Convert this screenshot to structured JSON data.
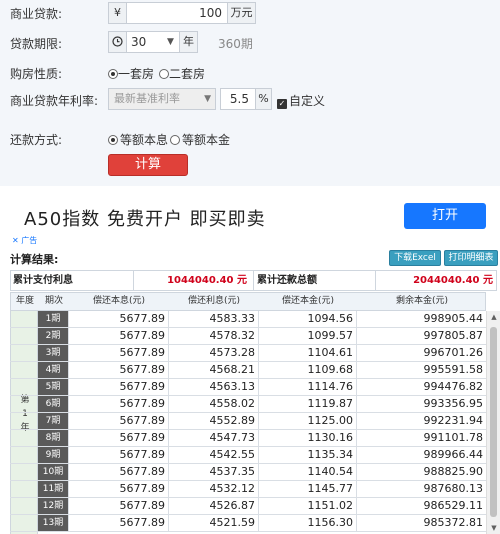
{
  "form": {
    "loan_amount": {
      "label": "商业贷款:",
      "prefix": "¥",
      "value": "100",
      "unit": "万元"
    },
    "loan_term": {
      "label": "贷款期限:",
      "value": "30",
      "unit": "年",
      "months": "360期"
    },
    "house_type": {
      "label": "购房性质:",
      "options": [
        "一套房",
        "二套房"
      ],
      "selected": "一套房"
    },
    "rate": {
      "label": "商业贷款年利率:",
      "select_value": "最新基准利率",
      "value": "5.5",
      "unit": "%",
      "custom_label": "自定义",
      "custom_checked": true
    },
    "repay_method": {
      "label": "还款方式:",
      "options": [
        "等额本息",
        "等额本金"
      ],
      "selected": "等额本息"
    },
    "calc_button": "计算"
  },
  "ad": {
    "text": "A50指数 免费开户 即买即卖",
    "button": "打开",
    "mark": "广告"
  },
  "result": {
    "title": "计算结果:",
    "download_button": "下载Excel",
    "print_button": "打印明细表",
    "summary": {
      "interest_label": "累计支付利息",
      "interest_value": "1044040.40 元",
      "total_label": "累计还款总额",
      "total_value": "2044040.40 元"
    },
    "columns": [
      "年度",
      "期次",
      "偿还本息(元)",
      "偿还利息(元)",
      "偿还本金(元)",
      "剩余本金(元)"
    ],
    "year_label": [
      "第",
      "1",
      "年"
    ],
    "rows": [
      {
        "period": "1期",
        "payment": "5677.89",
        "interest": "4583.33",
        "principal": "1094.56",
        "remaining": "998905.44"
      },
      {
        "period": "2期",
        "payment": "5677.89",
        "interest": "4578.32",
        "principal": "1099.57",
        "remaining": "997805.87"
      },
      {
        "period": "3期",
        "payment": "5677.89",
        "interest": "4573.28",
        "principal": "1104.61",
        "remaining": "996701.26"
      },
      {
        "period": "4期",
        "payment": "5677.89",
        "interest": "4568.21",
        "principal": "1109.68",
        "remaining": "995591.58"
      },
      {
        "period": "5期",
        "payment": "5677.89",
        "interest": "4563.13",
        "principal": "1114.76",
        "remaining": "994476.82"
      },
      {
        "period": "6期",
        "payment": "5677.89",
        "interest": "4558.02",
        "principal": "1119.87",
        "remaining": "993356.95"
      },
      {
        "period": "7期",
        "payment": "5677.89",
        "interest": "4552.89",
        "principal": "1125.00",
        "remaining": "992231.94"
      },
      {
        "period": "8期",
        "payment": "5677.89",
        "interest": "4547.73",
        "principal": "1130.16",
        "remaining": "991101.78"
      },
      {
        "period": "9期",
        "payment": "5677.89",
        "interest": "4542.55",
        "principal": "1135.34",
        "remaining": "989966.44"
      },
      {
        "period": "10期",
        "payment": "5677.89",
        "interest": "4537.35",
        "principal": "1140.54",
        "remaining": "988825.90"
      },
      {
        "period": "11期",
        "payment": "5677.89",
        "interest": "4532.12",
        "principal": "1145.77",
        "remaining": "987680.13"
      },
      {
        "period": "12期",
        "payment": "5677.89",
        "interest": "4526.87",
        "principal": "1151.02",
        "remaining": "986529.11"
      },
      {
        "period": "13期",
        "payment": "5677.89",
        "interest": "4521.59",
        "principal": "1156.30",
        "remaining": "985372.81"
      }
    ]
  },
  "colors": {
    "accent_red": "#e0413a",
    "ad_blue": "#1677ff",
    "table_button": "#3a9fbf",
    "summary_value": "#d0021b"
  }
}
